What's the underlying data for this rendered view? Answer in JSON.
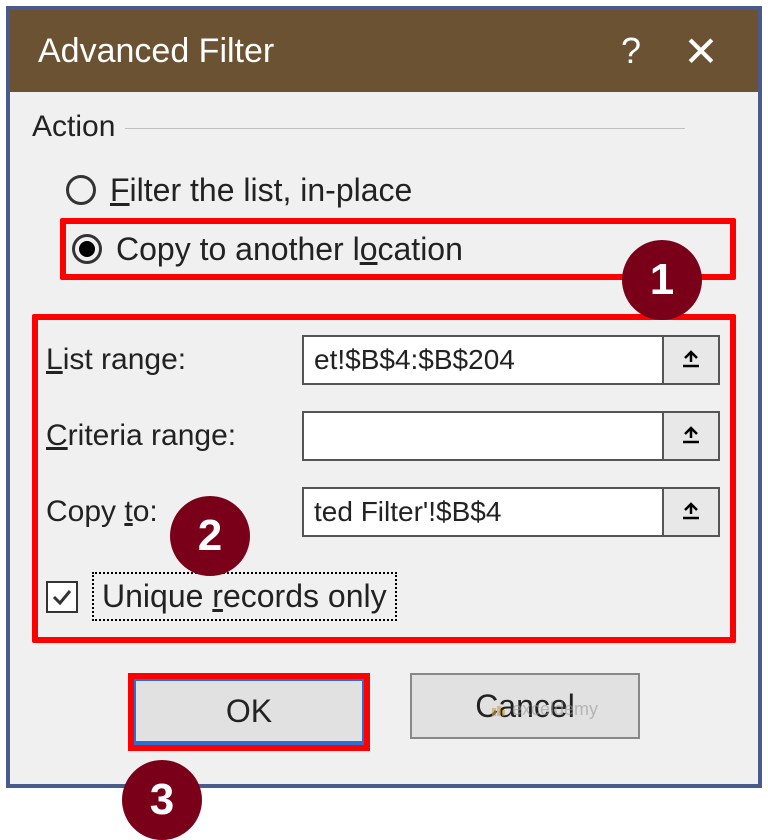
{
  "title": "Advanced Filter",
  "action": {
    "label": "Action",
    "option1": "Filter the list, in-place",
    "option2": "Copy to another location"
  },
  "ranges": {
    "list_label": "List range:",
    "list_value": "et!$B$4:$B$204",
    "criteria_label": "Criteria range:",
    "criteria_value": "",
    "copy_label": "Copy to:",
    "copy_value": "ted Filter'!$B$4"
  },
  "unique_label": "Unique records only",
  "buttons": {
    "ok": "OK",
    "cancel": "Cancel"
  },
  "badges": {
    "b1": "1",
    "b2": "2",
    "b3": "3"
  },
  "watermark": "exceldemy"
}
